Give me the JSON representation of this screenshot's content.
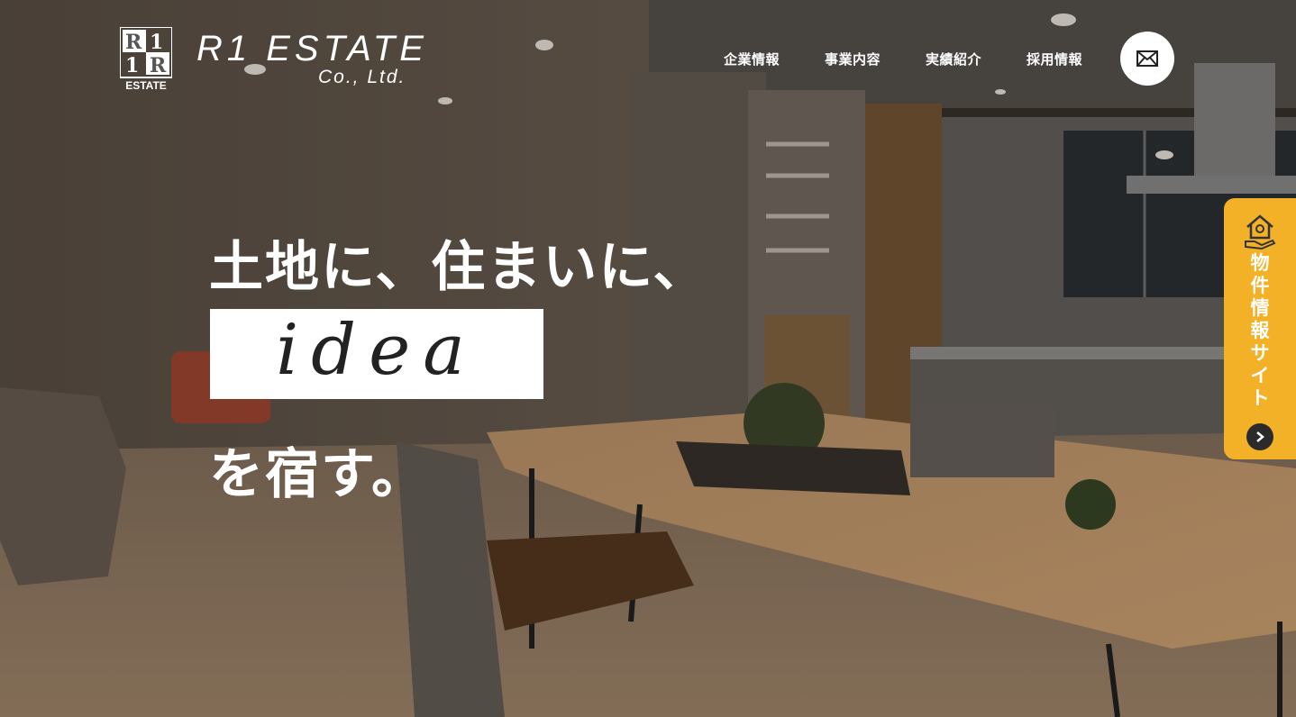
{
  "brand": {
    "name": "R1 ESTATE",
    "sub": "Co., Ltd.",
    "mark_text": "ESTATE"
  },
  "nav": {
    "items": [
      {
        "label": "企業情報"
      },
      {
        "label": "事業内容"
      },
      {
        "label": "実績紹介"
      },
      {
        "label": "採用情報"
      }
    ],
    "mail_icon": "envelope-icon"
  },
  "hero": {
    "line1": "土地に、住まいに、",
    "highlight": "idea",
    "line2": "を宿す。"
  },
  "side_tab": {
    "label": "物件情報サイト",
    "icon": "house-hand-icon",
    "arrow_icon": "chevron-right-icon",
    "color": "#f3b128"
  }
}
